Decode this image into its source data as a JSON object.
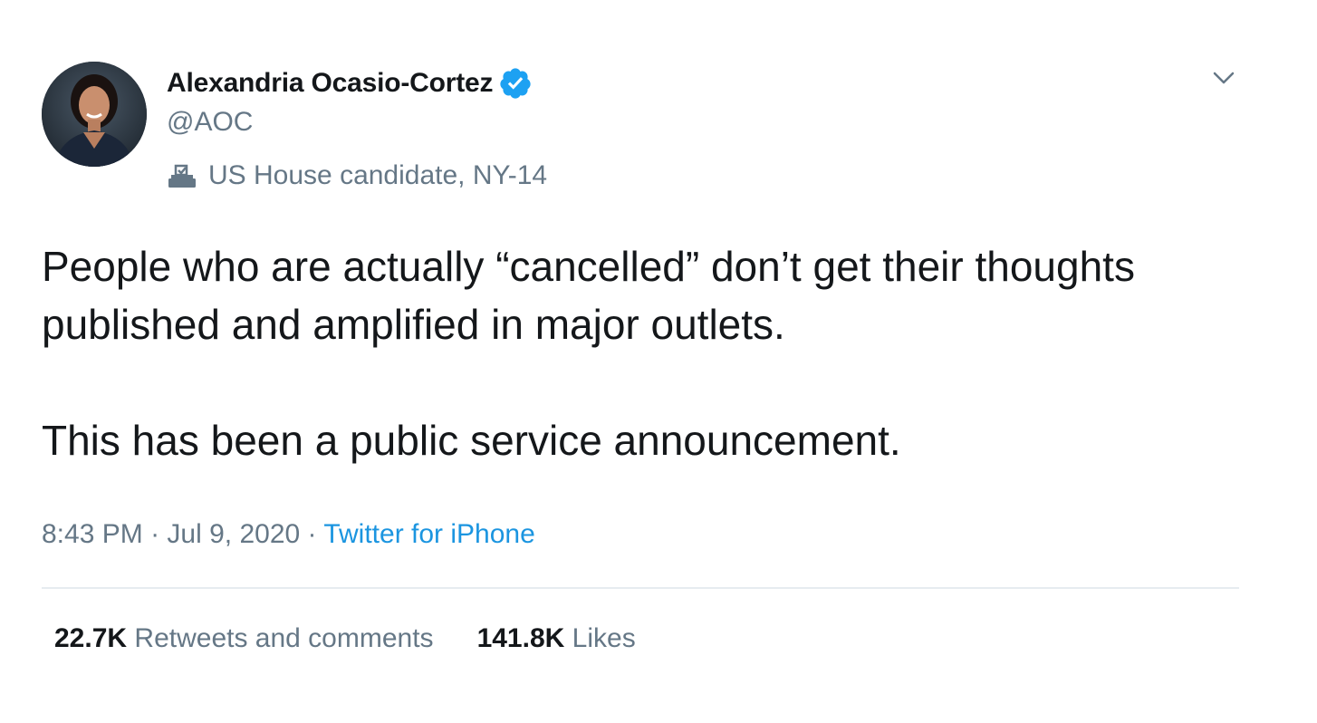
{
  "author": {
    "display_name": "Alexandria Ocasio-Cortez",
    "handle": "@AOC",
    "verified": true,
    "avatar_icon": "profile-photo",
    "account_label_icon": "ballot-box-icon",
    "account_label": "US House candidate, NY-14"
  },
  "tweet": {
    "paragraphs": [
      "People who are actually “cancelled” don’t get their thoughts published and amplified in major outlets.",
      "This has been a public service announcement."
    ],
    "time": "8:43 PM",
    "separator": "·",
    "date": "Jul 9, 2020",
    "source": "Twitter for iPhone"
  },
  "stats": {
    "retweets_count": "22.7K",
    "retweets_label": "Retweets and comments",
    "likes_count": "141.8K",
    "likes_label": "Likes"
  },
  "colors": {
    "text": "#14171a",
    "secondary": "#657786",
    "link": "#1b95e0",
    "verified_badge": "#1da1f2",
    "divider": "#e6ecf0"
  },
  "menu": {
    "icon": "chevron-down-icon"
  }
}
